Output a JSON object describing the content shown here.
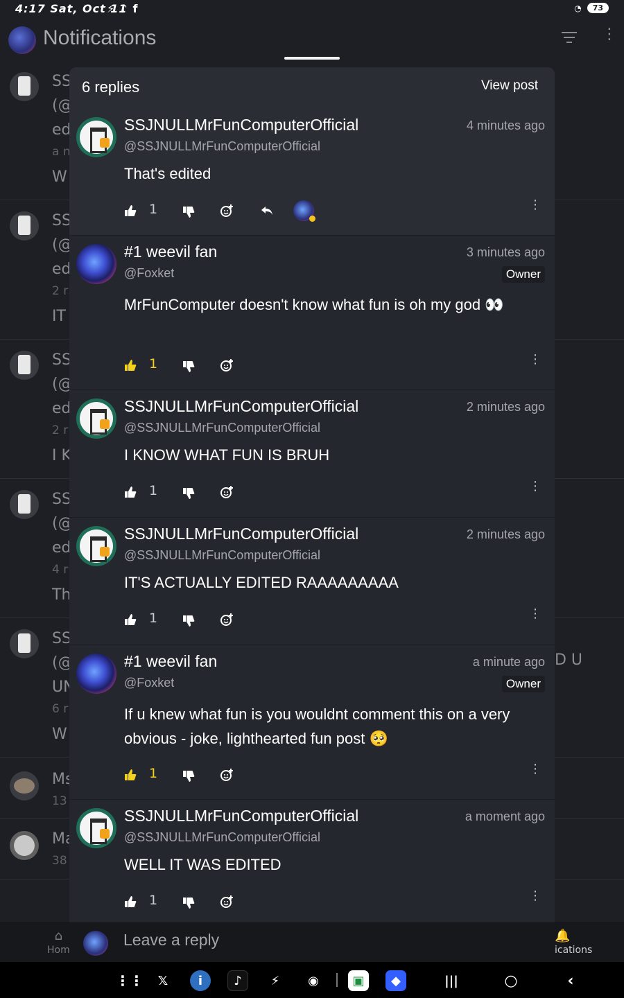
{
  "status_bar": {
    "time": "4:17",
    "date": "Sat, Oct 11",
    "battery": "73"
  },
  "app": {
    "title": "Notifications"
  },
  "background_rows": [
    {
      "line1": "SS",
      "line2": "(@",
      "line3": "ed",
      "line4": "a n",
      "line5": "W"
    },
    {
      "line1": "SS",
      "line2": "(@",
      "line3": "ed",
      "line4": "2 r",
      "line5": "IT"
    },
    {
      "line1": "SS",
      "line2": "(@",
      "line3": "ed",
      "line4": "2 r",
      "line5": "I K"
    },
    {
      "line1": "SS",
      "line2": "(@",
      "line3": "ed",
      "line4": "4 r",
      "line5": "Th"
    },
    {
      "line1": "SS",
      "line2": "(@",
      "line3": "UN",
      "line4": "6 r",
      "line5": "W"
    },
    {
      "line1": "Ms",
      "line2": "13"
    },
    {
      "line1": "Ma",
      "line2": "38"
    }
  ],
  "background_overflow_text": "D U",
  "bottom_nav": {
    "home_label": "Hom",
    "notifications_label": "ications"
  },
  "sheet": {
    "title": "6 replies",
    "view_post_label": "View post",
    "reply_placeholder": "Leave a reply",
    "comments": [
      {
        "name": "SSJNULLMrFunComputerOfficial",
        "handle": "@SSJNULLMrFunComputerOfficial",
        "time": "4 minutes ago",
        "body": "That's edited",
        "likes": "1",
        "liked": false,
        "owner": false
      },
      {
        "name": "#1 weevil fan",
        "handle": "@Foxket",
        "time": "3 minutes ago",
        "body": "MrFunComputer doesn't know what fun is oh my god 👀",
        "likes": "1",
        "liked": true,
        "owner": true,
        "owner_label": "Owner"
      },
      {
        "name": "SSJNULLMrFunComputerOfficial",
        "handle": "@SSJNULLMrFunComputerOfficial",
        "time": "2 minutes ago",
        "body": "I KNOW WHAT FUN IS BRUH",
        "likes": "1",
        "liked": false,
        "owner": false
      },
      {
        "name": "SSJNULLMrFunComputerOfficial",
        "handle": "@SSJNULLMrFunComputerOfficial",
        "time": "2 minutes ago",
        "body": "IT'S ACTUALLY EDITED RAAAAAAAAA",
        "likes": "1",
        "liked": false,
        "owner": false
      },
      {
        "name": "#1 weevil fan",
        "handle": "@Foxket",
        "time": "a minute ago",
        "body": "If u knew what fun is you wouldnt comment this on a very obvious - joke, lighthearted fun post 🥺",
        "likes": "1",
        "liked": true,
        "owner": true,
        "owner_label": "Owner"
      },
      {
        "name": "SSJNULLMrFunComputerOfficial",
        "handle": "@SSJNULLMrFunComputerOfficial",
        "time": "a moment ago",
        "body": "WELL IT WAS EDITED",
        "likes": "1",
        "liked": false,
        "owner": false
      }
    ]
  },
  "colors": {
    "liked_accent": "#f2d21b",
    "sheet_bg": "#24272e",
    "page_bg": "#1d1f24"
  }
}
